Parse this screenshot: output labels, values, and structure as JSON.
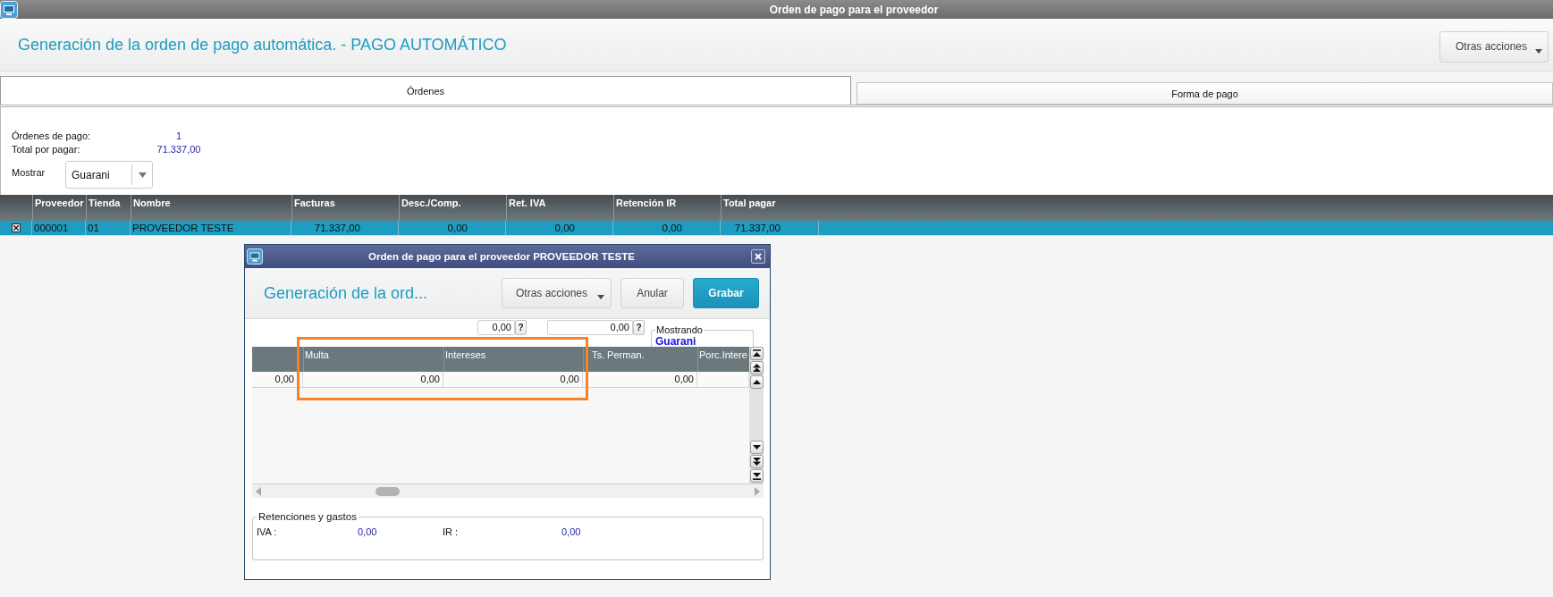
{
  "window": {
    "title": "Orden de pago para el proveedor"
  },
  "header": {
    "title": "Generación de la orden de pago automática. - PAGO AUTOMÁTICO",
    "actions_button": "Otras acciones"
  },
  "tabs": [
    {
      "label": "Órdenes",
      "selected": true
    },
    {
      "label": "Forma de pago",
      "selected": false
    }
  ],
  "summary": [
    {
      "label": "Órdenes de pago:",
      "value": "1"
    },
    {
      "label": "Total por pagar:",
      "value": "71.337,00"
    }
  ],
  "show_filter": {
    "label": "Mostrar",
    "value": "Guarani"
  },
  "orders_table": {
    "columns": [
      "Proveedor",
      "Tienda",
      "Nombre",
      "Facturas",
      "Desc./Comp.",
      "Ret. IVA",
      "Retención IR",
      "Total pagar"
    ],
    "rows": [
      {
        "checked": true,
        "selected": true,
        "cells": [
          "000001",
          "01",
          "PROVEEDOR TESTE",
          "71.337,00",
          "0,00",
          "0,00",
          "0,00",
          "71.337,00"
        ]
      }
    ]
  },
  "dialog": {
    "title": "Orden de pago para el proveedor PROVEEDOR TESTE",
    "heading": "Generación de la ord...",
    "buttons": [
      {
        "label": "Otras acciones",
        "kind": "menu"
      },
      {
        "label": "Anular",
        "kind": "secondary"
      },
      {
        "label": "Grabar",
        "kind": "primary"
      }
    ],
    "amount_fields": [
      {
        "value": "0,00",
        "help": "?"
      },
      {
        "value": "0,00",
        "help": "?"
      }
    ],
    "showing": {
      "label": "Mostrando",
      "value": "Guarani"
    },
    "grid": {
      "columns": [
        {
          "label": "Multa",
          "highlighted": true
        },
        {
          "label": "Intereses",
          "highlighted": true
        },
        {
          "label": "Ts. Perman.",
          "highlighted": false
        },
        {
          "label": "Porc.Intere",
          "highlighted": false
        }
      ],
      "rows": [
        {
          "leading_cell": "0,00",
          "cells": [
            "0,00",
            "0,00",
            "0,00"
          ]
        }
      ]
    },
    "retentions": {
      "title": "Retenciones y gastos",
      "items": [
        {
          "label": "IVA :",
          "value": "0,00"
        },
        {
          "label": "IR :",
          "value": "0,00"
        }
      ]
    }
  }
}
